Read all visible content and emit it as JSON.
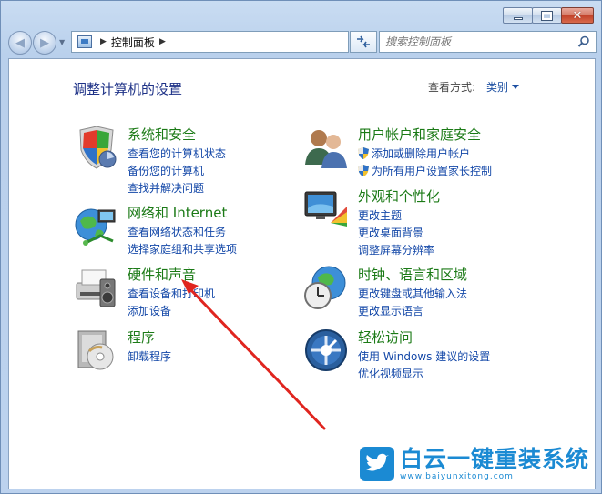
{
  "window": {
    "address_label": "控制面板",
    "search_placeholder": "搜索控制面板",
    "caption": {
      "minimize": "minimize-icon",
      "maximize": "maximize-icon",
      "close": "close-icon"
    }
  },
  "main": {
    "title": "调整计算机的设置",
    "view_by_label": "查看方式:",
    "view_by_value": "类别"
  },
  "categories": [
    {
      "title": "系统和安全",
      "icon": "system-security-icon",
      "links": [
        {
          "label": "查看您的计算机状态",
          "shield": false
        },
        {
          "label": "备份您的计算机",
          "shield": false
        },
        {
          "label": "查找并解决问题",
          "shield": false
        }
      ]
    },
    {
      "title": "网络和 Internet",
      "icon": "network-internet-icon",
      "links": [
        {
          "label": "查看网络状态和任务",
          "shield": false
        },
        {
          "label": "选择家庭组和共享选项",
          "shield": false
        }
      ]
    },
    {
      "title": "硬件和声音",
      "icon": "hardware-sound-icon",
      "links": [
        {
          "label": "查看设备和打印机",
          "shield": false
        },
        {
          "label": "添加设备",
          "shield": false
        }
      ]
    },
    {
      "title": "程序",
      "icon": "programs-icon",
      "links": [
        {
          "label": "卸载程序",
          "shield": false
        }
      ]
    },
    {
      "title": "用户帐户和家庭安全",
      "icon": "user-accounts-icon",
      "links": [
        {
          "label": "添加或删除用户帐户",
          "shield": true
        },
        {
          "label": "为所有用户设置家长控制",
          "shield": true
        }
      ]
    },
    {
      "title": "外观和个性化",
      "icon": "appearance-icon",
      "links": [
        {
          "label": "更改主题",
          "shield": false
        },
        {
          "label": "更改桌面背景",
          "shield": false
        },
        {
          "label": "调整屏幕分辨率",
          "shield": false
        }
      ]
    },
    {
      "title": "时钟、语言和区域",
      "icon": "clock-language-icon",
      "links": [
        {
          "label": "更改键盘或其他输入法",
          "shield": false
        },
        {
          "label": "更改显示语言",
          "shield": false
        }
      ]
    },
    {
      "title": "轻松访问",
      "icon": "ease-of-access-icon",
      "links": [
        {
          "label": "使用 Windows 建议的设置",
          "shield": false
        },
        {
          "label": "优化视频显示",
          "shield": false
        }
      ]
    }
  ],
  "watermark": {
    "brand": "白云一键重装系统",
    "url": "www.baiyunxitong.com"
  },
  "colors": {
    "title_green": "#1b7a16",
    "link_blue": "#1448a8",
    "heading_navy": "#1e3287",
    "annotation_red": "#e0251f"
  }
}
